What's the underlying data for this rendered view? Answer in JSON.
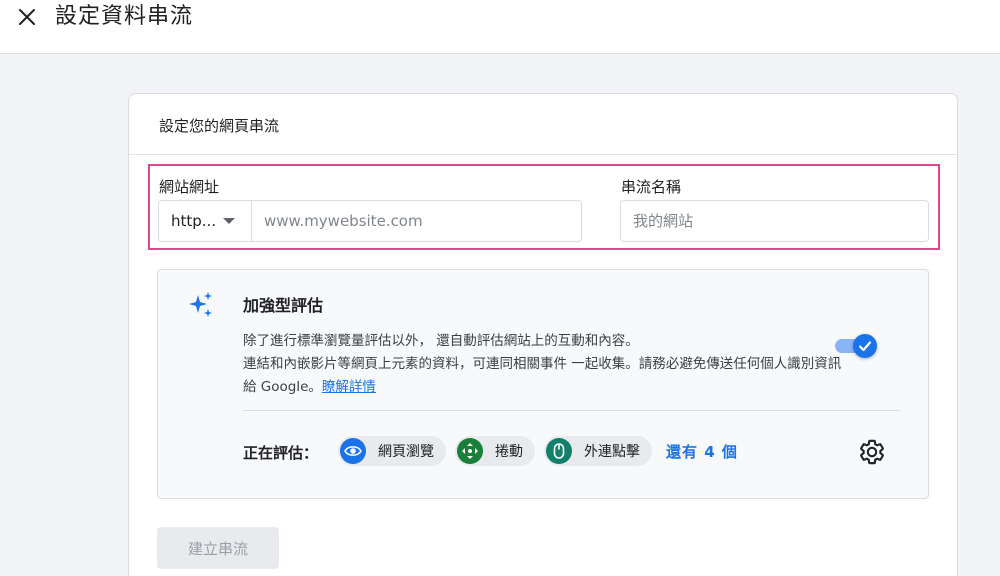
{
  "header": {
    "title": "設定資料串流"
  },
  "card": {
    "title": "設定您的網頁串流"
  },
  "form": {
    "url_label": "網站網址",
    "protocol_value": "http...",
    "url_placeholder": "www.mywebsite.com",
    "stream_name_label": "串流名稱",
    "stream_name_placeholder": "我的網站"
  },
  "enhanced": {
    "title": "加強型評估",
    "desc_line1": "除了進行標準瀏覽量評估以外， 還自動評估網站上的互動和內容。",
    "desc_line2": "連結和內嵌影片等網頁上元素的資料，可連同相關事件 一起收集。請務必避免傳送任何個人識別資訊給 Google。",
    "learn_more": "瞭解詳情",
    "toggle_on": true,
    "measuring_label": "正在評估：",
    "chips": [
      {
        "label": "網頁瀏覽",
        "icon": "eye-icon",
        "color": "#1a73e8"
      },
      {
        "label": "捲動",
        "icon": "scroll-arrows-icon",
        "color": "#188038"
      },
      {
        "label": "外連點擊",
        "icon": "mouse-icon",
        "color": "#12806a"
      }
    ],
    "more_link": "還有 4 個"
  },
  "actions": {
    "create_button": "建立串流"
  },
  "colors": {
    "accent": "#1a73e8",
    "highlight": "#e0478e"
  }
}
